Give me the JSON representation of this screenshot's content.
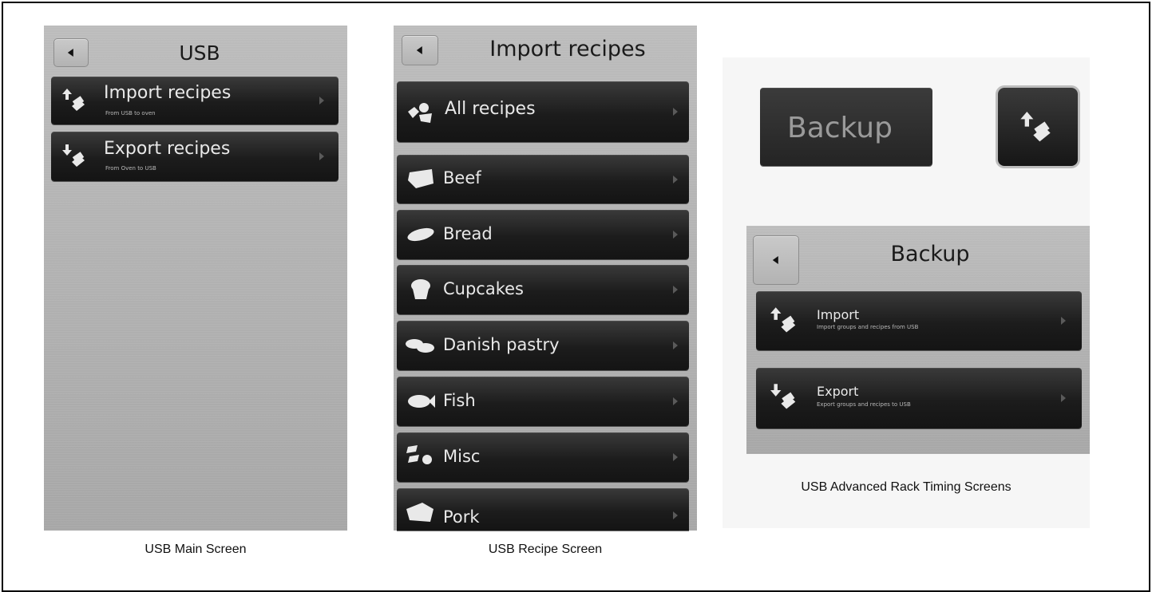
{
  "usb_main": {
    "title": "USB",
    "items": [
      {
        "label": "Import recipes",
        "sub": "From USB to oven",
        "icon": "usb-upload-icon"
      },
      {
        "label": "Export recipes",
        "sub": "From Oven to USB",
        "icon": "usb-download-icon"
      }
    ],
    "caption": "USB Main Screen"
  },
  "usb_recipe": {
    "title": "Import recipes",
    "all_label": "All recipes",
    "items": [
      {
        "label": "Beef",
        "icon": "beef-icon"
      },
      {
        "label": "Bread",
        "icon": "bread-icon"
      },
      {
        "label": "Cupcakes",
        "icon": "cupcake-icon"
      },
      {
        "label": "Danish pastry",
        "icon": "danish-pastry-icon"
      },
      {
        "label": "Fish",
        "icon": "fish-icon"
      },
      {
        "label": "Misc",
        "icon": "misc-icon"
      },
      {
        "label": "Pork",
        "icon": "pork-icon"
      }
    ],
    "caption": "USB Recipe Screen"
  },
  "advanced": {
    "backup_button_label": "Backup",
    "title": "Backup",
    "items": [
      {
        "label": "Import",
        "sub": "Import groups and recipes from USB",
        "icon": "usb-upload-icon"
      },
      {
        "label": "Export",
        "sub": "Export groups and recipes to USB",
        "icon": "usb-download-icon"
      }
    ],
    "caption": "USB Advanced Rack Timing Screens"
  },
  "colors": {
    "row_dark": "#1c1c1c",
    "panel_gray": "#b0b0b0",
    "row_text": "#e9e9e9"
  }
}
